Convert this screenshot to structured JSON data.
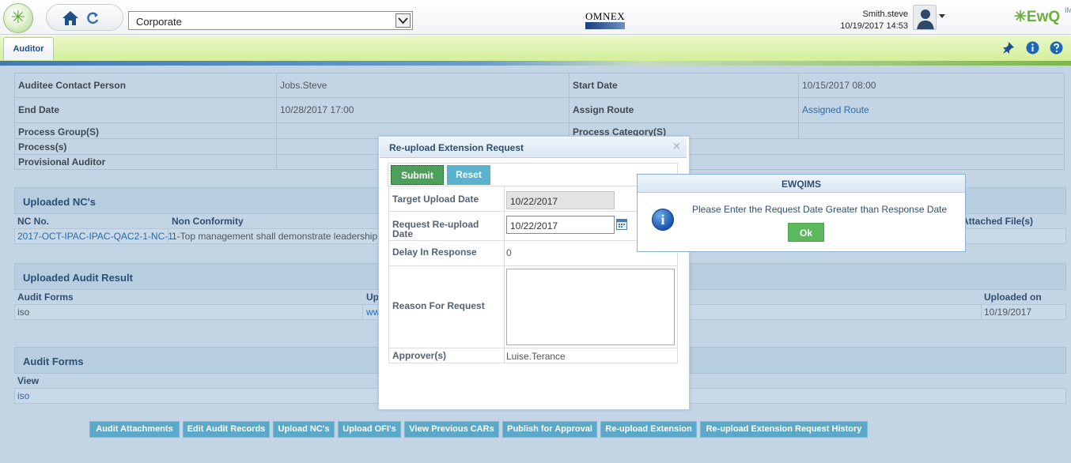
{
  "header": {
    "org_value": "Corporate",
    "omnex_label": "OMNEX",
    "user_name": "Smith.steve",
    "datetime": "10/19/2017 14:53",
    "brand_text": "EwQ",
    "brand_sub": "IMS",
    "brand_color": "#6bae3b"
  },
  "tabs": {
    "active": "Auditor"
  },
  "header_icons": [
    "pin-icon",
    "info-icon",
    "help-icon"
  ],
  "details": {
    "auditee_contact_label": "Auditee Contact Person",
    "auditee_contact_value": "Jobs.Steve",
    "start_date_label": "Start Date",
    "start_date_value": "10/15/2017 08:00",
    "end_date_label": "End Date",
    "end_date_value": "10/28/2017 17:00",
    "assign_route_label": "Assign Route",
    "assign_route_value": "Assigned Route",
    "process_group_label": "Process Group(S)",
    "process_category_label": "Process Category(S)",
    "process_label": "Process(s)",
    "provisional_auditor_label": "Provisional Auditor"
  },
  "uploaded_ncs": {
    "title": "Uploaded NC's",
    "columns": [
      "NC No.",
      "Non Conformity",
      "Attached File(s)"
    ],
    "rows": [
      {
        "nc_no": "2017-OCT-IPAC-IPAC-QAC2-1-NC-1",
        "non_conformity": "1-Top management shall demonstrate leadership"
      }
    ]
  },
  "uploaded_audit_result": {
    "title": "Uploaded Audit Result",
    "columns": [
      "Audit Forms",
      "Up",
      "Uploaded on"
    ],
    "rows": [
      {
        "form": "iso",
        "uploaded": "ww",
        "uploaded_on": "10/19/2017"
      }
    ]
  },
  "audit_forms": {
    "title": "Audit Forms",
    "column": "View",
    "rows": [
      "iso"
    ]
  },
  "bottom_buttons": [
    "Audit Attachments",
    "Edit Audit Records",
    "Upload NC's",
    "Upload OFI's",
    "View Previous CARs",
    "Publish for Approval",
    "Re-upload Extension",
    "Re-upload Extension Request History"
  ],
  "dialog": {
    "title": "Re-upload Extension Request",
    "close_glyph": "×",
    "submit_label": "Submit",
    "reset_label": "Reset",
    "target_upload_label": "Target Upload Date",
    "target_upload_value": "10/22/2017",
    "request_reupload_label_line1": "Request Re-upload",
    "request_reupload_label_line2": "Date",
    "request_reupload_value": "10/22/2017",
    "delay_label": "Delay In Response",
    "delay_value": "0",
    "reason_label": "Reason For Request",
    "approvers_label": "Approver(s)",
    "approvers_value": "Luise.Terance"
  },
  "alert": {
    "title": "EWQIMS",
    "icon_glyph": "i",
    "message": "Please Enter the Request Date Greater than Response Date",
    "ok_label": "Ok"
  },
  "colors": {
    "accent_green": "#4f9f5c",
    "accent_blue": "#5ba8c8",
    "header_blue": "#2d4f73"
  }
}
